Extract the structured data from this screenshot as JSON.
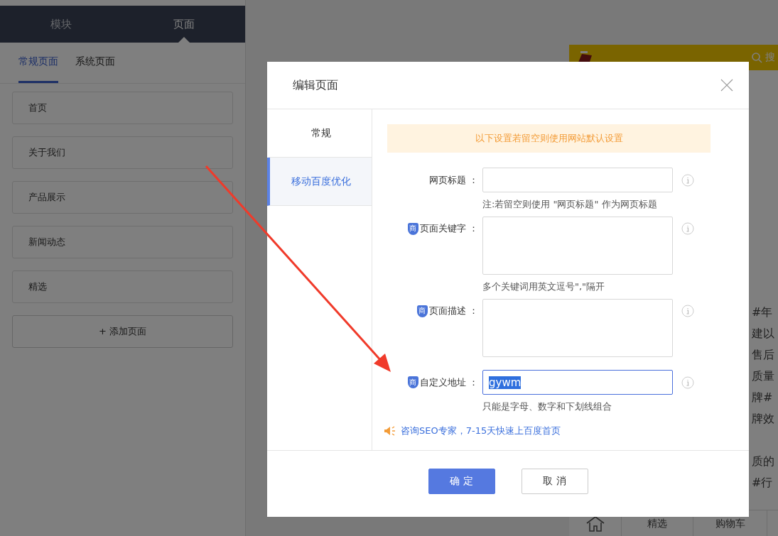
{
  "sidebar": {
    "tabs": [
      {
        "label": "模块",
        "selected": false
      },
      {
        "label": "页面",
        "selected": true
      }
    ],
    "subtabs": [
      {
        "label": "常规页面",
        "selected": true
      },
      {
        "label": "系统页面",
        "selected": false
      }
    ],
    "pages": [
      "首页",
      "关于我们",
      "产品展示",
      "新闻动态",
      "精选"
    ],
    "add_button": "+ 添加页面"
  },
  "preview": {
    "search_label": "搜",
    "lines": [
      "#年",
      "建以",
      "售后",
      "质量",
      "牌#",
      "牌效"
    ],
    "lower_lines": [
      "质的",
      "#行"
    ],
    "nav": [
      {
        "kind": "icon"
      },
      {
        "kind": "text",
        "label": "精选"
      },
      {
        "kind": "text",
        "label": "购物车"
      }
    ]
  },
  "dialog": {
    "title": "编辑页面",
    "tabs": [
      {
        "label": "常规",
        "selected": false
      },
      {
        "label": "移动百度优化",
        "selected": true
      }
    ],
    "notice": "以下设置若留空则使用网站默认设置",
    "fields": [
      {
        "label": "网页标题 ：",
        "kind": "input",
        "focused": false,
        "hint": "注:若留空则使用 \"网页标题\" 作为网页标题"
      },
      {
        "badge": "商",
        "label": "页面关键字 ：",
        "kind": "textarea",
        "focused": false,
        "hint": "多个关键词用英文逗号\",\"隔开"
      },
      {
        "badge": "商",
        "label": "页面描述 ：",
        "kind": "textarea",
        "focused": false
      },
      {
        "badge": "商",
        "label": "自定义地址 ：",
        "kind": "input",
        "focused": true,
        "value": "gywm",
        "value_selected": true,
        "hint": "只能是字母、数字和下划线组合"
      }
    ],
    "link": "咨询SEO专家，7-15天快速上百度首页",
    "buttons": [
      {
        "label": "确 定",
        "kind": "primary"
      },
      {
        "label": "取 消",
        "kind": "secondary"
      }
    ]
  }
}
